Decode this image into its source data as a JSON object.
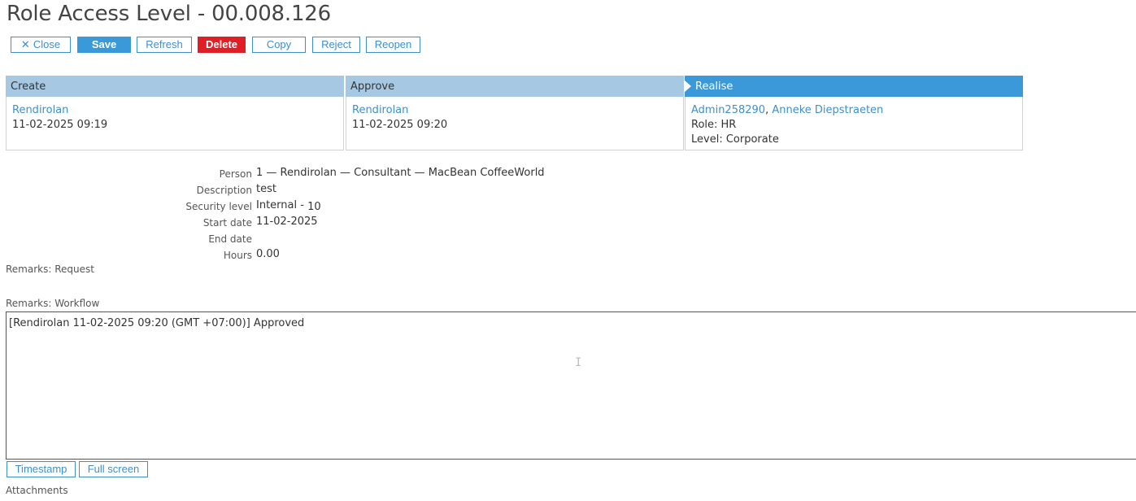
{
  "page": {
    "title": "Role Access Level - 00.008.126"
  },
  "toolbar": {
    "close_label": "Close",
    "save_label": "Save",
    "refresh_label": "Refresh",
    "delete_label": "Delete",
    "copy_label": "Copy",
    "reject_label": "Reject",
    "reopen_label": "Reopen"
  },
  "stages": {
    "create": {
      "header": "Create",
      "user": "Rendirolan",
      "timestamp": "11-02-2025 09:19"
    },
    "approve": {
      "header": "Approve",
      "user": "Rendirolan",
      "timestamp": "11-02-2025 09:20"
    },
    "realise": {
      "header": "Realise",
      "user_1": "Admin258290",
      "separator": ", ",
      "user_2": "Anneke Diepstraeten",
      "role": "Role: HR",
      "level": "Level: Corporate"
    }
  },
  "fields": {
    "person": {
      "label": "Person",
      "value": "1 — Rendirolan — Consultant — MacBean CoffeeWorld"
    },
    "description": {
      "label": "Description",
      "value": "test"
    },
    "security_level": {
      "label": "Security level",
      "value": "Internal - ",
      "value_suffix": "10"
    },
    "start_date": {
      "label": "Start date",
      "value": "11-02-2025"
    },
    "end_date": {
      "label": "End date",
      "value": ""
    },
    "hours": {
      "label": "Hours",
      "value": "0.00"
    }
  },
  "remarks": {
    "request_label": "Remarks: Request",
    "workflow_label": "Remarks: Workflow",
    "workflow_text": "[Rendirolan 11-02-2025 09:20 (GMT +07:00)] Approved",
    "timestamp_button": "Timestamp",
    "fullscreen_button": "Full screen"
  },
  "attachments": {
    "label": "Attachments"
  },
  "colors": {
    "accent": "#3a9ad9",
    "danger": "#e01e26",
    "stage_inactive": "#a7c8e2",
    "stage_active": "#3b98d9",
    "link": "#3f8fce"
  },
  "icons": {
    "close": "close-icon",
    "stage_active": "chevron-right-icon",
    "text_cursor": "text-cursor-icon"
  }
}
